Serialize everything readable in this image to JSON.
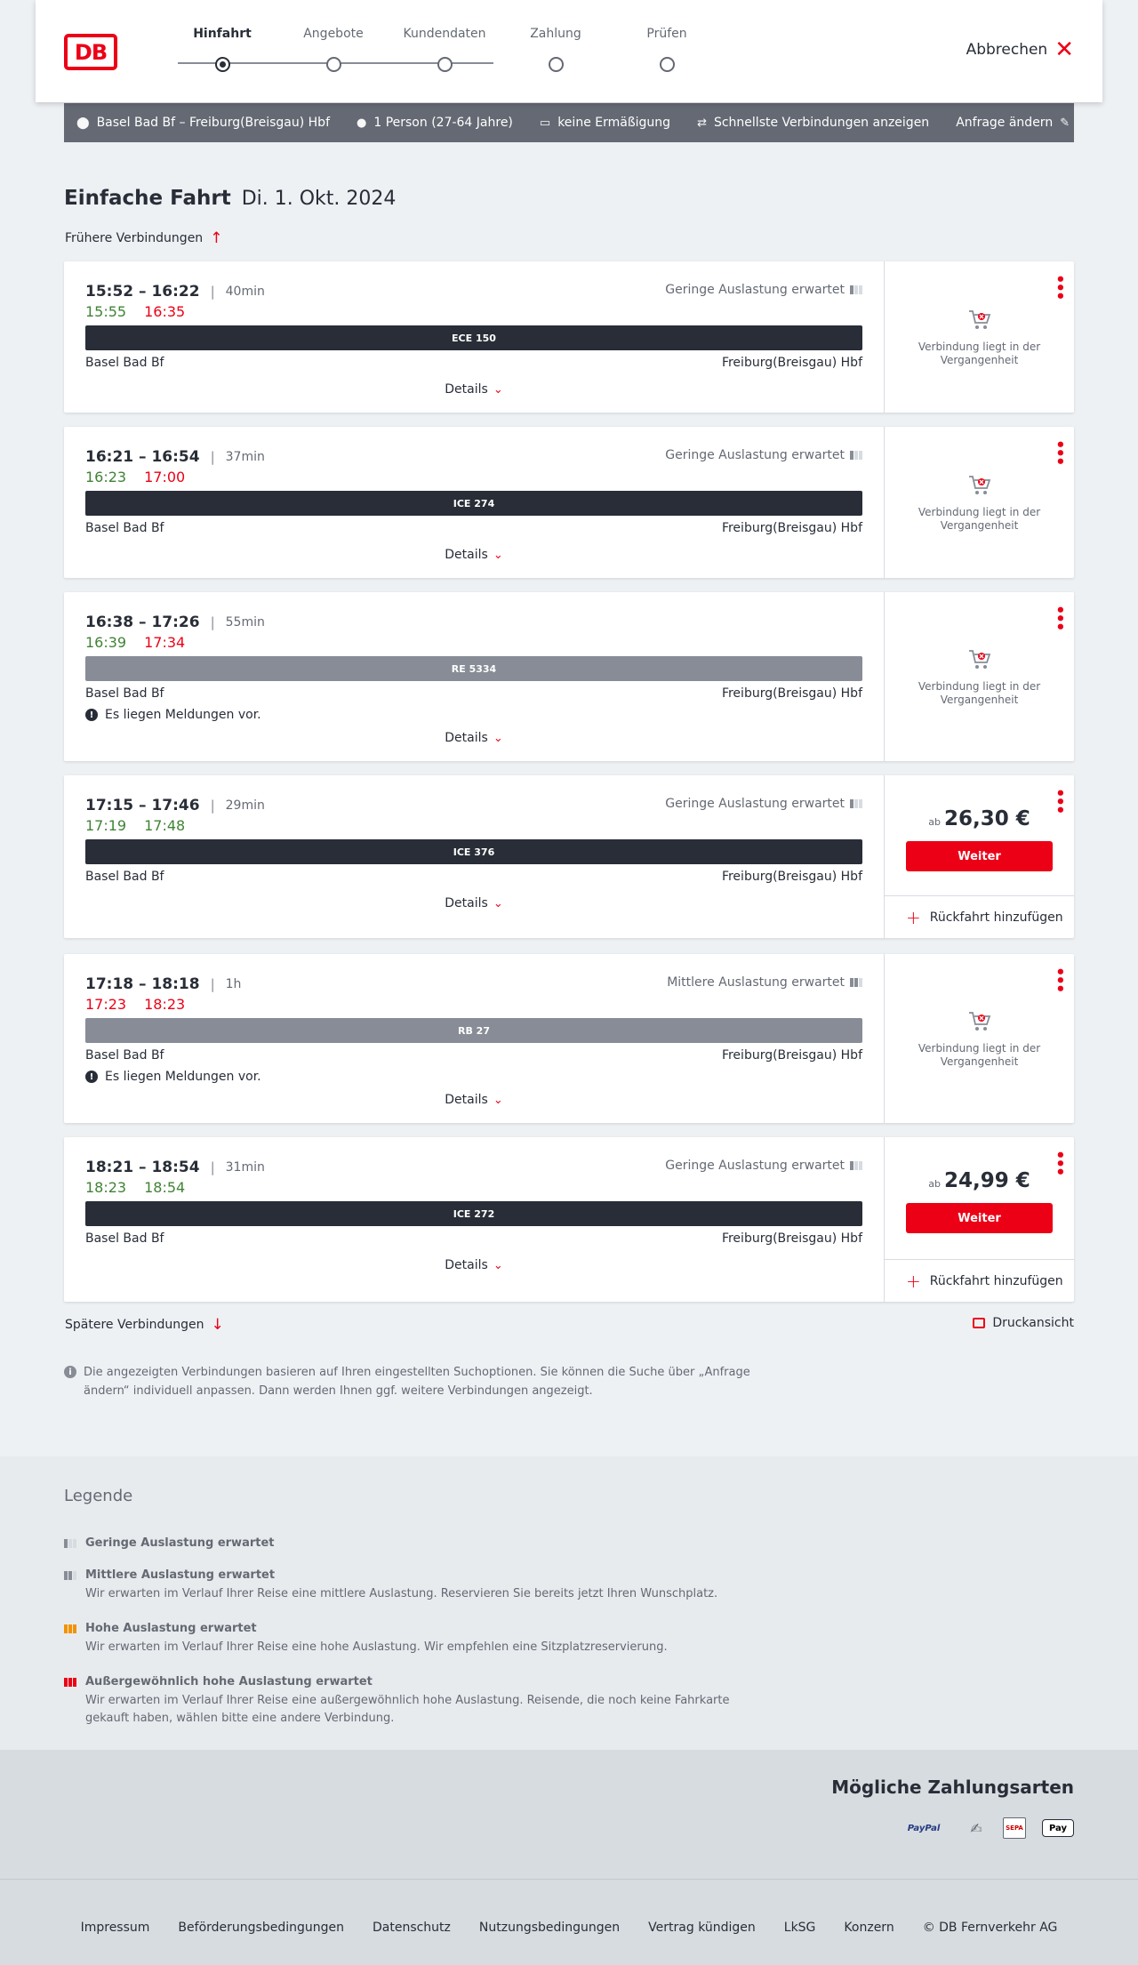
{
  "header": {
    "logo": "DB",
    "steps": [
      "Hinfahrt",
      "Angebote",
      "Kundendaten",
      "Zahlung",
      "Prüfen"
    ],
    "active_step": 0,
    "cancel_label": "Abbrechen"
  },
  "search": {
    "route": "Basel Bad Bf – Freiburg(Breisgau) Hbf",
    "persons": "1 Person (27-64 Jahre)",
    "discount": "keine Ermäßigung",
    "fastest": "Schnellste Verbindungen anzeigen",
    "edit": "Anfrage ändern"
  },
  "title": {
    "main": "Einfache Fahrt",
    "date": "Di. 1. Okt. 2024"
  },
  "earlier_label": "Frühere Verbindungen",
  "later_label": "Spätere Verbindungen",
  "print_label": "Druckansicht",
  "details_label": "Details",
  "past_text": "Verbindung liegt in der Vergangenheit",
  "return_label": "Rückfahrt hinzufügen",
  "weiter_label": "Weiter",
  "price_prefix": "ab",
  "connections": [
    {
      "times": "15:52 – 16:22",
      "duration": "40min",
      "rt_dep": "15:55",
      "rt_dep_status": "green",
      "rt_arr": "16:35",
      "rt_arr_status": "red",
      "occupancy": "Geringe Auslastung erwartet",
      "train": "ECE 150",
      "train_type": "long",
      "from": "Basel Bad Bf",
      "to": "Freiburg(Breisgau) Hbf",
      "message": "",
      "state": "past"
    },
    {
      "times": "16:21 – 16:54",
      "duration": "37min",
      "rt_dep": "16:23",
      "rt_dep_status": "green",
      "rt_arr": "17:00",
      "rt_arr_status": "red",
      "occupancy": "Geringe Auslastung erwartet",
      "train": "ICE 274",
      "train_type": "long",
      "from": "Basel Bad Bf",
      "to": "Freiburg(Breisgau) Hbf",
      "message": "",
      "state": "past"
    },
    {
      "times": "16:38 – 17:26",
      "duration": "55min",
      "rt_dep": "16:39",
      "rt_dep_status": "green",
      "rt_arr": "17:34",
      "rt_arr_status": "red",
      "occupancy": "",
      "train": "RE 5334",
      "train_type": "regional",
      "from": "Basel Bad Bf",
      "to": "Freiburg(Breisgau) Hbf",
      "message": "Es liegen Meldungen vor.",
      "state": "past"
    },
    {
      "times": "17:15 – 17:46",
      "duration": "29min",
      "rt_dep": "17:19",
      "rt_dep_status": "green",
      "rt_arr": "17:48",
      "rt_arr_status": "green",
      "occupancy": "Geringe Auslastung erwartet",
      "train": "ICE 376",
      "train_type": "long",
      "from": "Basel Bad Bf",
      "to": "Freiburg(Breisgau) Hbf",
      "message": "",
      "state": "bookable",
      "price": "26,30 €"
    },
    {
      "times": "17:18 – 18:18",
      "duration": "1h",
      "rt_dep": "17:23",
      "rt_dep_status": "red",
      "rt_arr": "18:23",
      "rt_arr_status": "red",
      "occupancy": "Mittlere Auslastung erwartet",
      "train": "RB 27",
      "train_type": "regional",
      "from": "Basel Bad Bf",
      "to": "Freiburg(Breisgau) Hbf",
      "message": "Es liegen Meldungen vor.",
      "state": "past"
    },
    {
      "times": "18:21 – 18:54",
      "duration": "31min",
      "rt_dep": "18:23",
      "rt_dep_status": "green",
      "rt_arr": "18:54",
      "rt_arr_status": "green",
      "occupancy": "Geringe Auslastung erwartet",
      "train": "ICE 272",
      "train_type": "long",
      "from": "Basel Bad Bf",
      "to": "Freiburg(Breisgau) Hbf",
      "message": "",
      "state": "bookable",
      "price": "24,99 €"
    }
  ],
  "info_note": "Die angezeigten Verbindungen basieren auf Ihren eingestellten Suchoptionen. Sie können die Suche über „Anfrage ändern“ individuell anpassen. Dann werden Ihnen ggf. weitere Verbindungen angezeigt.",
  "legend": {
    "title": "Legende",
    "items": [
      {
        "title": "Geringe Auslastung erwartet",
        "desc": "",
        "level": 1
      },
      {
        "title": "Mittlere Auslastung erwartet",
        "desc": "Wir erwarten im Verlauf Ihrer Reise eine mittlere Auslastung. Reservieren Sie bereits jetzt Ihren Wunschplatz.",
        "level": 2
      },
      {
        "title": "Hohe Auslastung erwartet",
        "desc": "Wir erwarten im Verlauf Ihrer Reise eine hohe Auslastung. Wir empfehlen eine Sitzplatzreservierung.",
        "level": 3
      },
      {
        "title": "Außergewöhnlich hohe Auslastung erwartet",
        "desc": "Wir erwarten im Verlauf Ihrer Reise eine außergewöhnlich hohe Auslastung. Reisende, die noch keine Fahrkarte gekauft haben, wählen bitte eine andere Verbindung.",
        "level": 4
      }
    ]
  },
  "payment": {
    "title": "Mögliche Zahlungsarten",
    "methods": [
      "PayPal",
      "lastschrift-icon",
      "SEPA",
      "Pay"
    ]
  },
  "footer": {
    "links": [
      "Impressum",
      "Beförderungsbedingungen",
      "Datenschutz",
      "Nutzungsbedingungen",
      "Vertrag kündigen",
      "LkSG",
      "Konzern",
      "© DB Fernverkehr AG"
    ]
  },
  "colors": {
    "accent": "#ec0016",
    "ontime": "#408335",
    "delayed": "#ec0016",
    "train_long": "#282d37",
    "train_regional": "#878c96",
    "searchbar": "#646973"
  }
}
